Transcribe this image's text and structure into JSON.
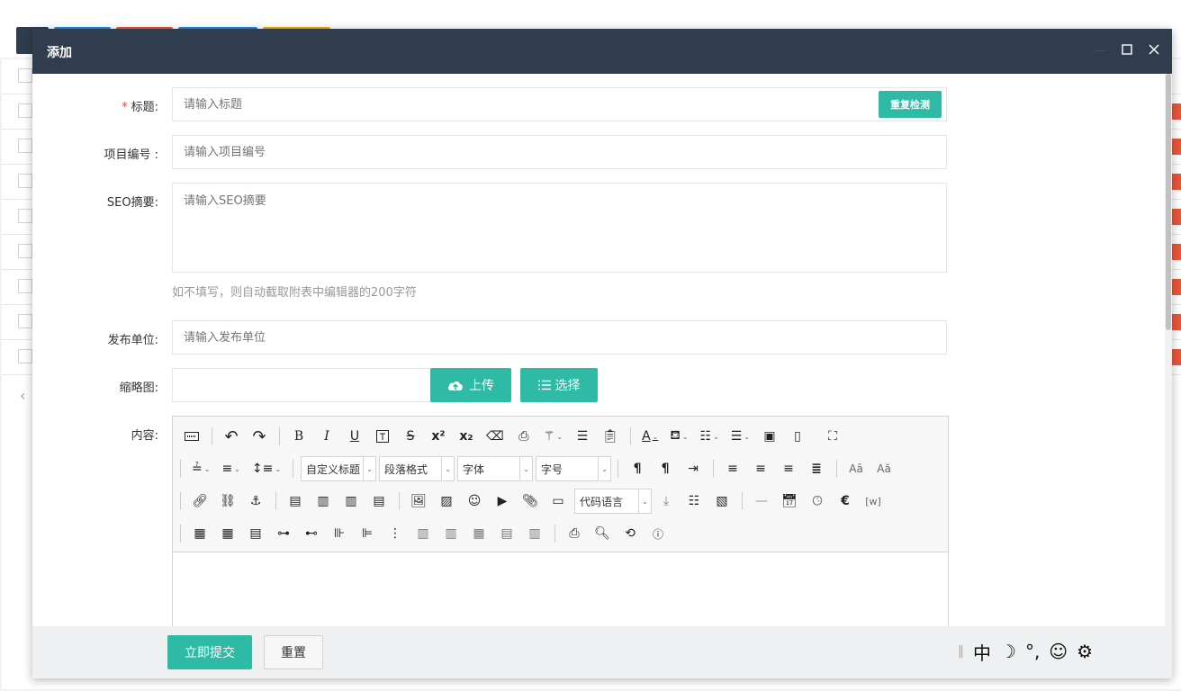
{
  "modal": {
    "title": "添加"
  },
  "form": {
    "title_label": "标题:",
    "title_placeholder": "请输入标题",
    "check_button": "重复检测",
    "project_label": "项目编号 :",
    "project_placeholder": "请输入项目编号",
    "seo_label": "SEO摘要:",
    "seo_placeholder": "请输入SEO摘要",
    "seo_hint": "如不填写，则自动截取附表中编辑器的200字符",
    "publisher_label": "发布单位:",
    "publisher_placeholder": "请输入发布单位",
    "thumb_label": "缩略图:",
    "upload_button": "上传",
    "select_button": "选择",
    "content_label": "内容:"
  },
  "editor": {
    "custom_title": "自定义标题",
    "paragraph": "段落格式",
    "font_family": "字体",
    "font_size": "字号",
    "code_language": "代码语言"
  },
  "footer": {
    "submit": "立即提交",
    "reset": "重置"
  },
  "ime": {
    "lang": "中",
    "items": [
      "☽",
      "°,",
      "☺",
      "⚙"
    ]
  },
  "colors": {
    "header": "#2f3d4e",
    "accent": "#2ebaa5",
    "required": "#ff4444"
  }
}
